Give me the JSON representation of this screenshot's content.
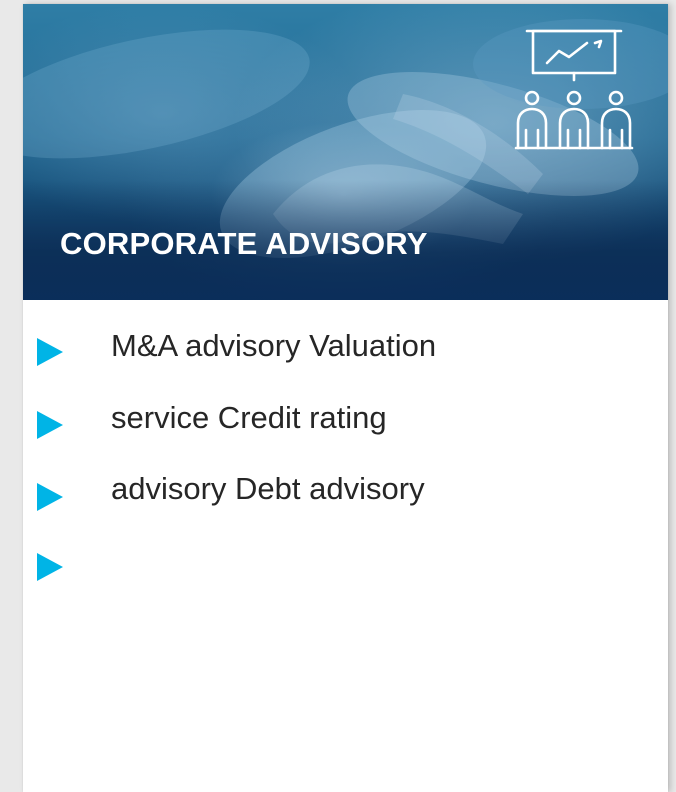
{
  "card": {
    "title": "CORPORATE ADVISORY",
    "header_icon": "presentation-meeting-icon",
    "bullet_icon": "triangle-bullet-icon",
    "accent_color": "#00b4e6",
    "banner_color": "#12416b",
    "text_color": "#262626",
    "items": [
      {
        "text": "M&A advisory  Valuation"
      },
      {
        "text": "service  Credit rating"
      },
      {
        "text": "advisory Debt advisory"
      },
      {
        "text": ""
      }
    ]
  }
}
